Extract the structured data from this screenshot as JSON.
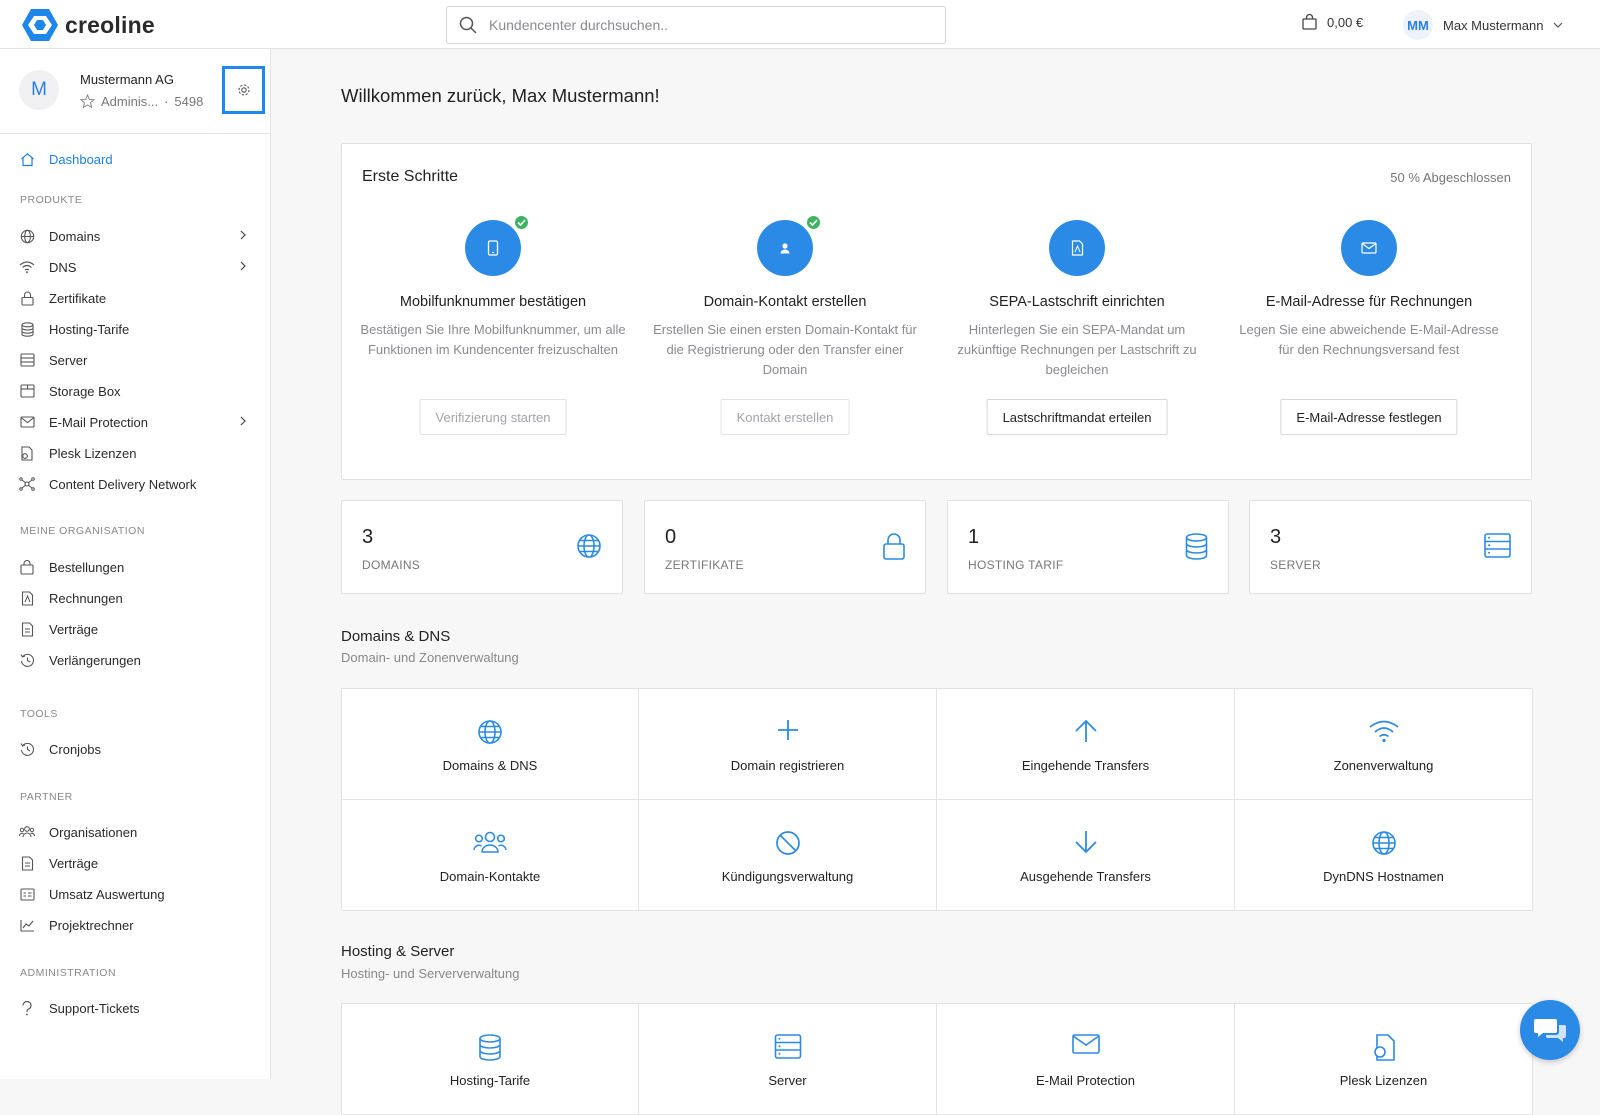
{
  "app": {
    "brand": "creoline",
    "accent": "#2b8ae6"
  },
  "header": {
    "search_placeholder": "Kundencenter durchsuchen..",
    "cart_amount": "0,00 €",
    "user_initials": "MM",
    "user_name": "Max Mustermann"
  },
  "organization": {
    "avatar_letter": "M",
    "name": "Mustermann AG",
    "role": "Adminis...",
    "id": "5498"
  },
  "sidebar": {
    "dashboard": "Dashboard",
    "sections": {
      "produkte": "PRODUKTE",
      "organisation": "MEINE ORGANISATION",
      "tools": "TOOLS",
      "partner": "PARTNER",
      "administration": "ADMINISTRATION"
    },
    "produkte": [
      "Domains",
      "DNS",
      "Zertifikate",
      "Hosting-Tarife",
      "Server",
      "Storage Box",
      "E-Mail Protection",
      "Plesk Lizenzen",
      "Content Delivery Network"
    ],
    "organisation": [
      "Bestellungen",
      "Rechnungen",
      "Verträge",
      "Verlängerungen"
    ],
    "tools": [
      "Cronjobs"
    ],
    "partner": [
      "Organisationen",
      "Verträge",
      "Umsatz Auswertung",
      "Projektrechner"
    ],
    "administration": [
      "Support-Tickets"
    ]
  },
  "main": {
    "welcome": "Willkommen zurück, Max Mustermann!",
    "steps": {
      "title": "Erste Schritte",
      "progress": "50 % Abgeschlossen",
      "items": [
        {
          "title": "Mobilfunknummer bestätigen",
          "desc": "Bestätigen Sie Ihre Mobilfunknummer, um alle Funktionen im Kundencenter freizuschalten",
          "button": "Verifizierung starten",
          "done": true
        },
        {
          "title": "Domain-Kontakt erstellen",
          "desc": "Erstellen Sie einen ersten Domain-Kontakt für die Registrierung oder den Transfer einer Domain",
          "button": "Kontakt erstellen",
          "done": true
        },
        {
          "title": "SEPA-Lastschrift einrichten",
          "desc": "Hinterlegen Sie ein SEPA-Mandat um zukünftige Rechnungen per Lastschrift zu begleichen",
          "button": "Lastschriftmandat erteilen",
          "done": false
        },
        {
          "title": "E-Mail-Adresse für Rechnungen",
          "desc": "Legen Sie eine abweichende E-Mail-Adresse für den Rechnungsversand fest",
          "button": "E-Mail-Adresse festlegen",
          "done": false
        }
      ]
    },
    "stats": [
      {
        "value": "3",
        "label": "DOMAINS"
      },
      {
        "value": "0",
        "label": "ZERTIFIKATE"
      },
      {
        "value": "1",
        "label": "HOSTING TARIF"
      },
      {
        "value": "3",
        "label": "SERVER"
      }
    ],
    "domains_section": {
      "title": "Domains & DNS",
      "subtitle": "Domain- und Zonenverwaltung",
      "tiles": [
        "Domains & DNS",
        "Domain registrieren",
        "Eingehende Transfers",
        "Zonenverwaltung",
        "Domain-Kontakte",
        "Kündigungsverwaltung",
        "Ausgehende Transfers",
        "DynDNS Hostnamen"
      ]
    },
    "hosting_section": {
      "title": "Hosting & Server",
      "subtitle": "Hosting- und Serververwaltung",
      "tiles": [
        "Hosting-Tarife",
        "Server",
        "E-Mail Protection",
        "Plesk Lizenzen"
      ]
    }
  }
}
